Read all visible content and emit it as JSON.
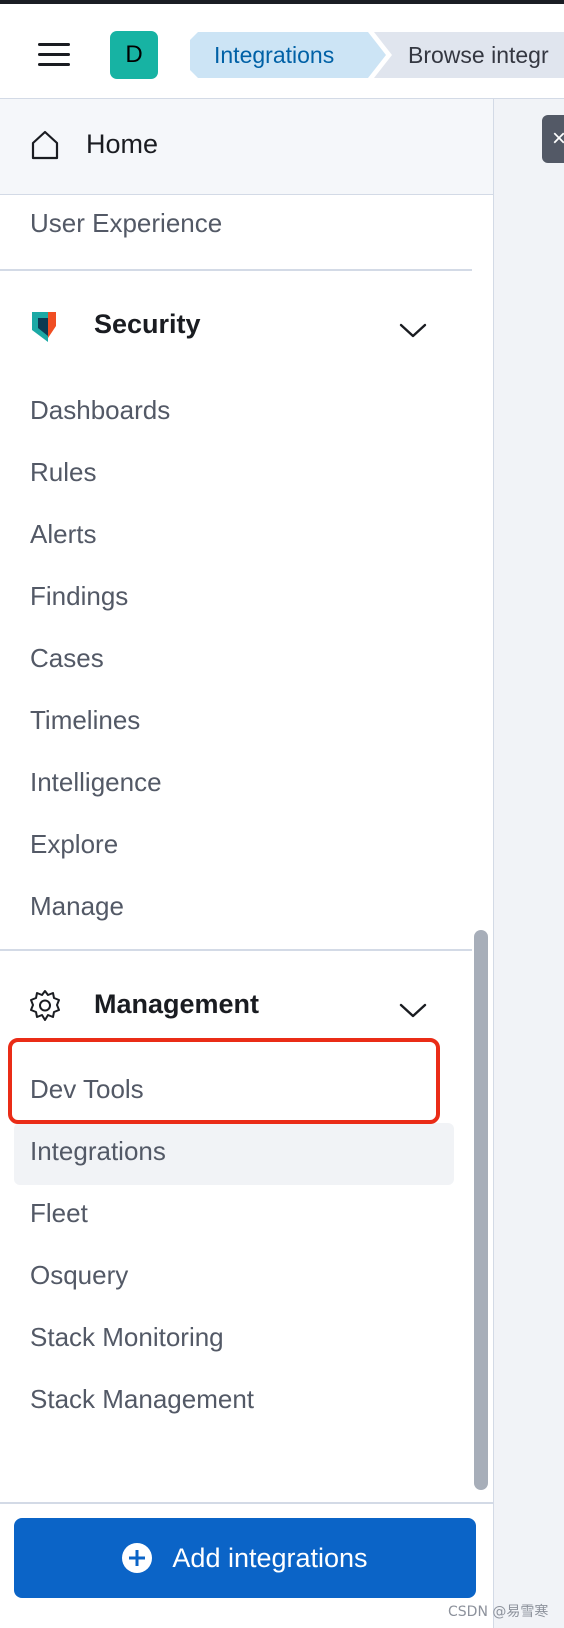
{
  "header": {
    "avatar_initial": "D",
    "breadcrumbs": [
      "Integrations",
      "Browse integr"
    ]
  },
  "nav": {
    "home_label": "Home",
    "user_experience": "User Experience",
    "security": {
      "title": "Security",
      "items": [
        "Dashboards",
        "Rules",
        "Alerts",
        "Findings",
        "Cases",
        "Timelines",
        "Intelligence",
        "Explore",
        "Manage"
      ]
    },
    "management": {
      "title": "Management",
      "items": [
        "Dev Tools",
        "Integrations",
        "Fleet",
        "Osquery",
        "Stack Monitoring",
        "Stack Management"
      ]
    }
  },
  "footer": {
    "add_button_label": "Add integrations"
  },
  "watermark": "CSDN @易雪寒",
  "colors": {
    "accent": "#0b64c7",
    "annotation": "#ea2c17",
    "avatar": "#17b3a3"
  }
}
